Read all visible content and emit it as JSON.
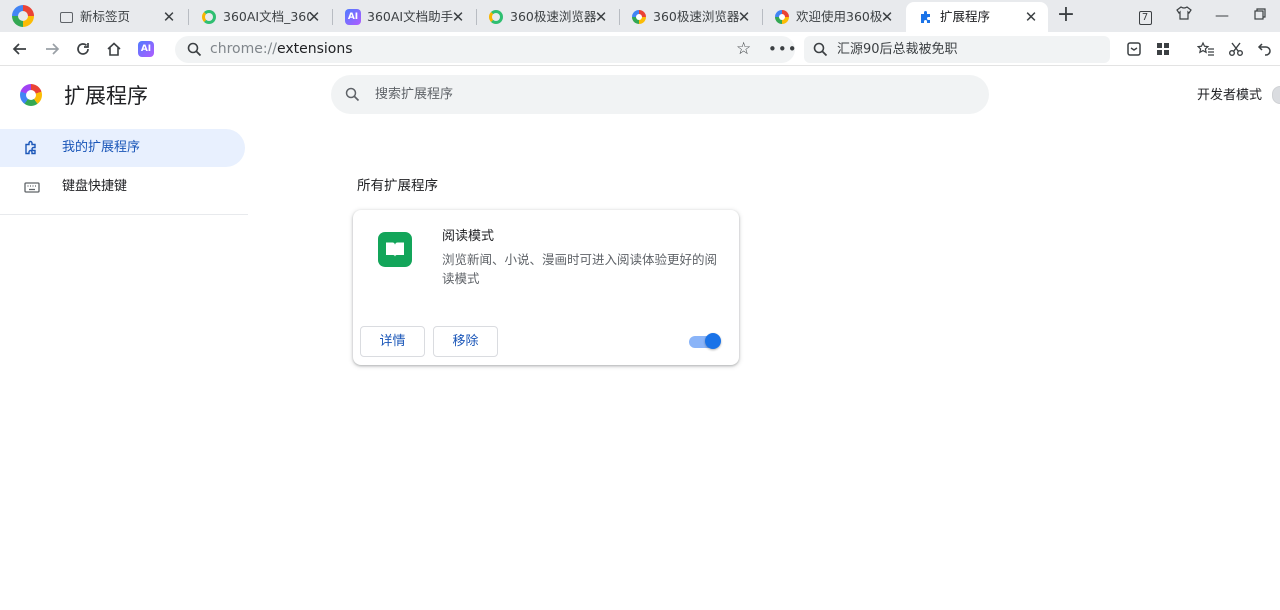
{
  "tabs": [
    {
      "title": "新标签页",
      "favicon": "new-tab-icon",
      "active": false
    },
    {
      "title": "360AI文档_360",
      "favicon": "search-q-icon",
      "active": false
    },
    {
      "title": "360AI文档助手",
      "favicon": "ai-assistant-icon",
      "active": false
    },
    {
      "title": "360极速浏览器",
      "favicon": "search-q-icon",
      "active": false
    },
    {
      "title": "360极速浏览器",
      "favicon": "browser-360-icon",
      "active": false
    },
    {
      "title": "欢迎使用360极",
      "favicon": "browser-360-icon",
      "active": false
    },
    {
      "title": "扩展程序",
      "favicon": "puzzle-icon",
      "active": true
    }
  ],
  "tab_badge": "7",
  "ai_button_label": "AI",
  "address_bar": {
    "scheme": "chrome://",
    "host": "extensions"
  },
  "search_box": {
    "text": "汇源90后总裁被免职"
  },
  "page": {
    "title": "扩展程序"
  },
  "extension_search": {
    "placeholder": "搜索扩展程序"
  },
  "developer_mode": {
    "label": "开发者模式",
    "enabled": false
  },
  "sidebar": {
    "items": [
      {
        "label": "我的扩展程序",
        "icon": "puzzle-outline-icon",
        "active": true
      },
      {
        "label": "键盘快捷键",
        "icon": "keyboard-icon",
        "active": false
      }
    ]
  },
  "section_title": "所有扩展程序",
  "extensions": [
    {
      "name": "阅读模式",
      "description": "浏览新闻、小说、漫画时可进入阅读体验更好的阅读模式",
      "icon": "book-icon",
      "details_label": "详情",
      "remove_label": "移除",
      "enabled": true
    }
  ],
  "colors": {
    "accent": "#1a73e8",
    "sidebar_active": "#e8f0fe",
    "extension_icon_bg": "#13a55a"
  }
}
